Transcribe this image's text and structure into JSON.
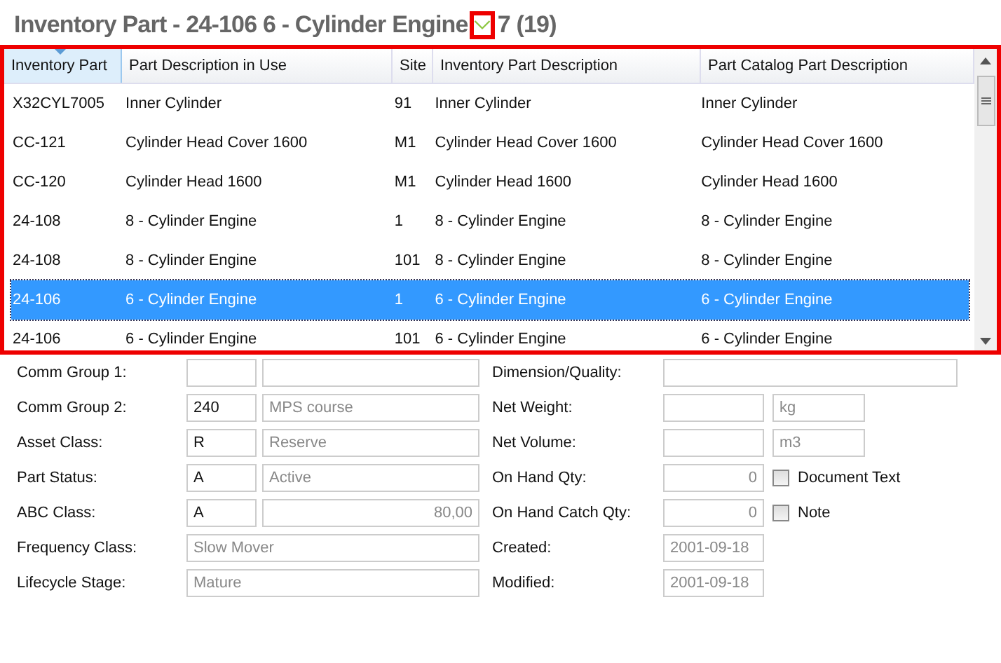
{
  "title": {
    "main": "Inventory Part - 24-106 6 - Cylinder Engine",
    "count": "7 (19)"
  },
  "table": {
    "columns": [
      {
        "label": "Inventory Part",
        "sorted": true
      },
      {
        "label": "Part Description in Use",
        "sorted": false
      },
      {
        "label": "Site",
        "sorted": false
      },
      {
        "label": "Inventory Part Description",
        "sorted": false
      },
      {
        "label": "Part Catalog Part Description",
        "sorted": false
      }
    ],
    "rows": [
      {
        "cells": [
          "X32CYL7005",
          "Inner Cylinder",
          "91",
          "Inner Cylinder",
          "Inner Cylinder"
        ],
        "selected": false
      },
      {
        "cells": [
          "CC-121",
          "Cylinder Head Cover 1600",
          "M1",
          "Cylinder Head Cover 1600",
          "Cylinder Head Cover 1600"
        ],
        "selected": false
      },
      {
        "cells": [
          "CC-120",
          "Cylinder Head 1600",
          "M1",
          "Cylinder Head 1600",
          "Cylinder Head 1600"
        ],
        "selected": false
      },
      {
        "cells": [
          "24-108",
          "8 - Cylinder Engine",
          "1",
          "8 - Cylinder Engine",
          "8 - Cylinder Engine"
        ],
        "selected": false
      },
      {
        "cells": [
          "24-108",
          "8 - Cylinder Engine",
          "101",
          "8 - Cylinder Engine",
          "8 - Cylinder Engine"
        ],
        "selected": false
      },
      {
        "cells": [
          "24-106",
          "6 - Cylinder Engine",
          "1",
          "6 - Cylinder Engine",
          "6 - Cylinder Engine"
        ],
        "selected": true
      },
      {
        "cells": [
          "24-106",
          "6 - Cylinder Engine",
          "101",
          "6 - Cylinder Engine",
          "6 - Cylinder Engine"
        ],
        "selected": false
      }
    ]
  },
  "form_left": [
    {
      "label": "Comm Group 1:",
      "fields": [
        {
          "kind": "code"
        },
        {
          "kind": "text"
        }
      ]
    },
    {
      "label": "Comm Group 2:",
      "fields": [
        {
          "kind": "code",
          "value": "240"
        },
        {
          "kind": "text",
          "value": "MPS course"
        }
      ]
    },
    {
      "label": "Asset Class:",
      "fields": [
        {
          "kind": "code",
          "value": "R"
        },
        {
          "kind": "text",
          "value": "Reserve"
        }
      ]
    },
    {
      "label": "Part Status:",
      "fields": [
        {
          "kind": "code",
          "value": "A"
        },
        {
          "kind": "text",
          "value": "Active"
        }
      ]
    },
    {
      "label": "ABC Class:",
      "fields": [
        {
          "kind": "code",
          "value": "A"
        },
        {
          "kind": "number",
          "value": "80,00"
        }
      ]
    },
    {
      "label": "Frequency Class:",
      "fields": [
        {
          "kind": "full",
          "value": "Slow Mover"
        }
      ]
    },
    {
      "label": "Lifecycle Stage:",
      "fields": [
        {
          "kind": "full",
          "value": "Mature"
        }
      ]
    }
  ],
  "form_right": [
    {
      "label": "Dimension/Quality:",
      "fields": [
        {
          "kind": "wide"
        }
      ]
    },
    {
      "label": "Net Weight:",
      "fields": [
        {
          "kind": "qty"
        },
        {
          "kind": "unit",
          "value": "kg"
        }
      ]
    },
    {
      "label": "Net Volume:",
      "fields": [
        {
          "kind": "qty"
        },
        {
          "kind": "unit",
          "value": "m3"
        }
      ]
    },
    {
      "label": "On Hand Qty:",
      "fields": [
        {
          "kind": "qty",
          "value": "0"
        },
        {
          "kind": "checkbox",
          "value": "Document Text",
          "checked": false
        }
      ]
    },
    {
      "label": "On Hand Catch Qty:",
      "fields": [
        {
          "kind": "qty",
          "value": "0"
        },
        {
          "kind": "checkbox",
          "value": "Note",
          "checked": false
        }
      ]
    },
    {
      "label": "Created:",
      "fields": [
        {
          "kind": "date",
          "value": "2001-09-18"
        }
      ]
    },
    {
      "label": "Modified:",
      "fields": [
        {
          "kind": "date",
          "value": "2001-09-18"
        }
      ]
    }
  ]
}
